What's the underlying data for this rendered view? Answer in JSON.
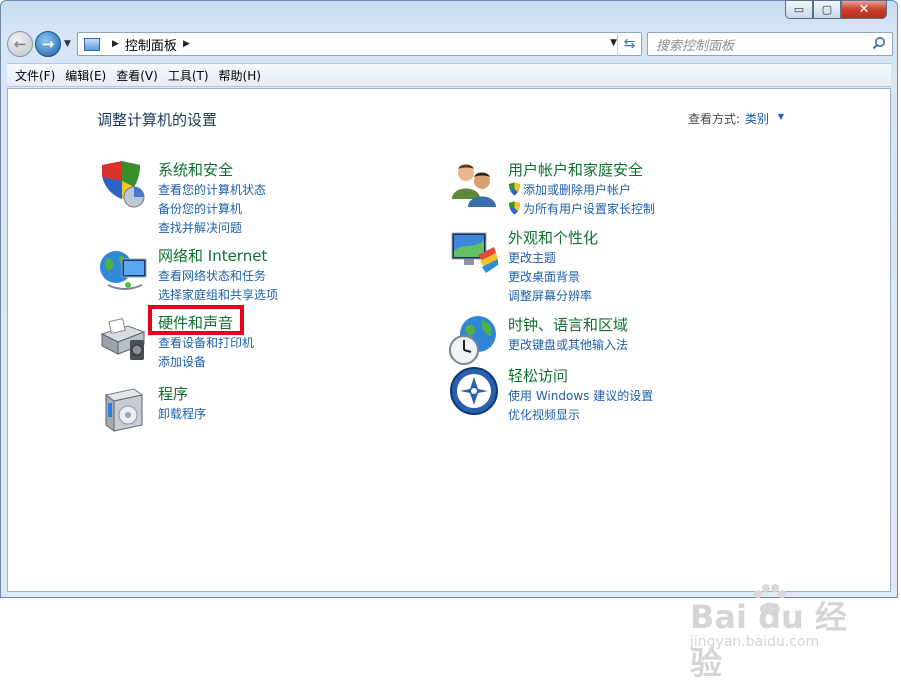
{
  "window": {
    "caption_buttons": {
      "minimize": "▭",
      "maximize": "▢",
      "close": "✕"
    },
    "nav": {
      "back_icon": "back-arrow-icon",
      "forward_icon": "forward-arrow-icon"
    },
    "address": {
      "crumb": "控制面板"
    },
    "search": {
      "placeholder": "搜索控制面板"
    }
  },
  "menubar": {
    "items": [
      {
        "label": "文件(F)"
      },
      {
        "label": "编辑(E)"
      },
      {
        "label": "查看(V)"
      },
      {
        "label": "工具(T)"
      },
      {
        "label": "帮助(H)"
      }
    ]
  },
  "page": {
    "title": "调整计算机的设置",
    "view_by_label": "查看方式:",
    "view_by_value": "类别"
  },
  "categories": [
    {
      "title": "系统和安全",
      "icon": "system-security-shield-icon",
      "links": [
        "查看您的计算机状态",
        "备份您的计算机",
        "查找并解决问题"
      ]
    },
    {
      "title": "网络和 Internet",
      "icon": "network-globe-icon",
      "links": [
        "查看网络状态和任务",
        "选择家庭组和共享选项"
      ]
    },
    {
      "title": "硬件和声音",
      "icon": "printer-hardware-icon",
      "links": [
        "查看设备和打印机",
        "添加设备"
      ]
    },
    {
      "title": "程序",
      "icon": "programs-box-icon",
      "links": [
        "卸载程序"
      ]
    },
    {
      "title": "用户帐户和家庭安全",
      "icon": "user-accounts-icon",
      "links": [
        "添加或删除用户帐户",
        "为所有用户设置家长控制"
      ]
    },
    {
      "title": "外观和个性化",
      "icon": "appearance-monitor-icon",
      "links": [
        "更改主题",
        "更改桌面背景",
        "调整屏幕分辨率"
      ]
    },
    {
      "title": "时钟、语言和区域",
      "icon": "clock-globe-icon",
      "links": [
        "更改键盘或其他输入法"
      ]
    },
    {
      "title": "轻松访问",
      "icon": "ease-of-access-icon",
      "links": [
        "使用 Windows 建议的设置",
        "优化视频显示"
      ]
    }
  ],
  "watermark": {
    "brand": "Bai du 经验",
    "url": "jingyan.baidu.com"
  },
  "colors": {
    "title_green": "#0f6f2f",
    "link_blue": "#1e5fa9",
    "highlight_red": "#e5001e"
  }
}
